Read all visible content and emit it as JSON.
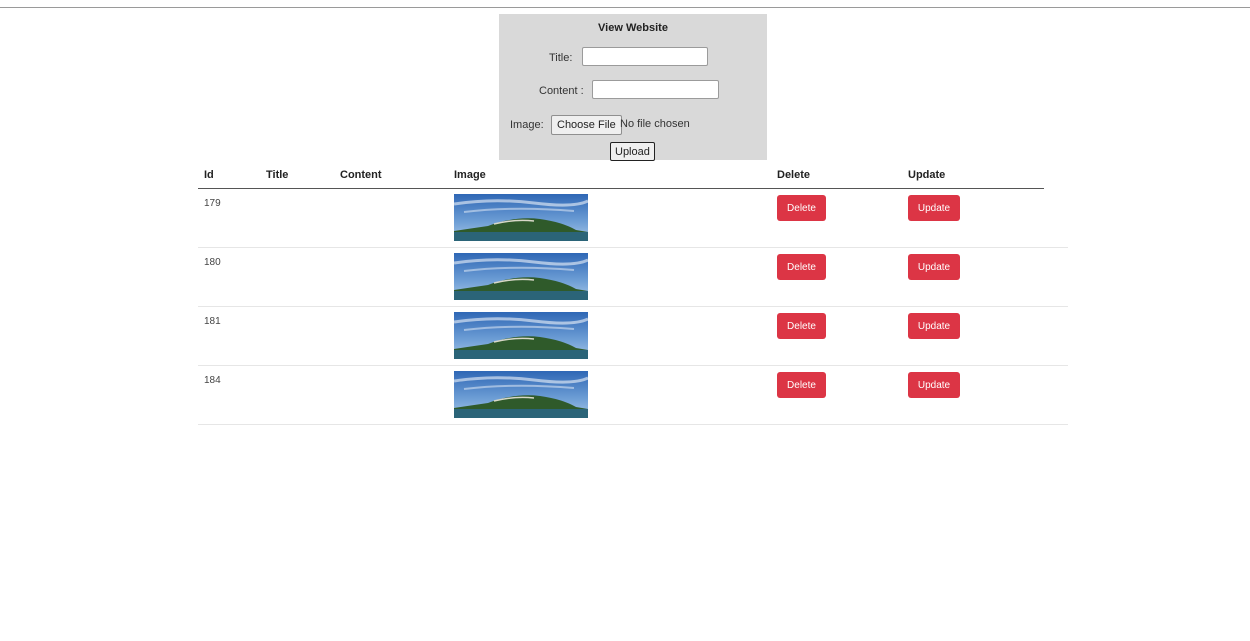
{
  "form": {
    "title": "View Website",
    "title_label": "Title:",
    "title_value": "",
    "content_label": "Content :",
    "content_value": "",
    "image_label": "Image:",
    "choose_file_label": "Choose File",
    "file_status": "No file chosen",
    "upload_label": "Upload"
  },
  "table": {
    "headers": {
      "id": "Id",
      "title": "Title",
      "content": "Content",
      "image": "Image",
      "delete": "Delete",
      "update": "Update"
    },
    "rows": [
      {
        "id": "179",
        "title": "",
        "content": "",
        "delete_label": "Delete",
        "update_label": "Update"
      },
      {
        "id": "180",
        "title": "",
        "content": "",
        "delete_label": "Delete",
        "update_label": "Update"
      },
      {
        "id": "181",
        "title": "",
        "content": "",
        "delete_label": "Delete",
        "update_label": "Update"
      },
      {
        "id": "184",
        "title": "",
        "content": "",
        "delete_label": "Delete",
        "update_label": "Update"
      }
    ]
  },
  "colors": {
    "button_red": "#dc3545",
    "form_background": "#d9d9d9"
  }
}
